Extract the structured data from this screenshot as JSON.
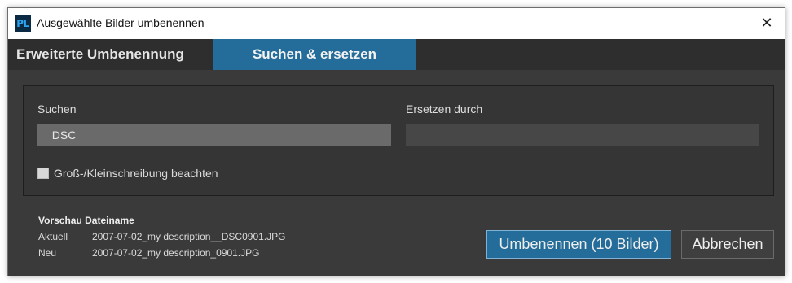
{
  "window": {
    "title": "Ausgewählte Bilder umbenennen",
    "app_icon_text": "PL",
    "close_glyph": "✕"
  },
  "tabs": [
    {
      "label": "Erweiterte Umbenennung",
      "active": false
    },
    {
      "label": "Suchen & ersetzen",
      "active": true
    }
  ],
  "search": {
    "label": "Suchen",
    "value": "_DSC",
    "placeholder": ""
  },
  "replace": {
    "label": "Ersetzen durch",
    "value": "",
    "placeholder": ""
  },
  "case_sensitive": {
    "label": "Groß-/Kleinschreibung beachten",
    "checked": false
  },
  "preview": {
    "title": "Vorschau Dateiname",
    "current_label": "Aktuell",
    "current_value": "2007-07-02_my description__DSC0901.JPG",
    "new_label": "Neu",
    "new_value": "2007-07-02_my description_0901.JPG"
  },
  "buttons": {
    "rename": "Umbenennen (10 Bilder)",
    "cancel": "Abbrechen"
  },
  "colors": {
    "accent": "#246c99",
    "background": "#3a3a3a",
    "panel": "#353535"
  }
}
